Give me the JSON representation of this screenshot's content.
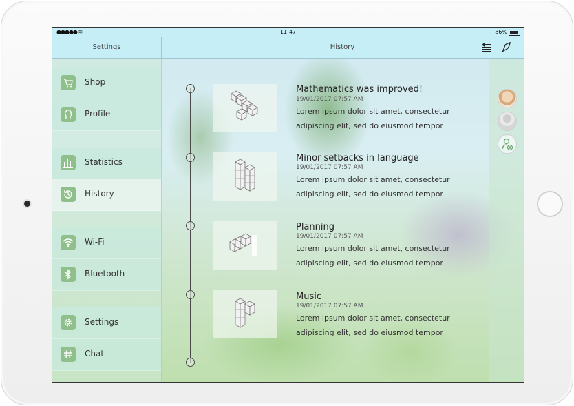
{
  "statusbar": {
    "signal": "●●●●● ≋",
    "time": "11:47",
    "battery": "86%"
  },
  "navbar": {
    "left_title": "Settings",
    "center_title": "History"
  },
  "sidebar": {
    "items": [
      {
        "label": "Shop",
        "icon": "cart-icon"
      },
      {
        "label": "Profile",
        "icon": "head-icon"
      },
      {
        "label": "Statistics",
        "icon": "bar-chart-icon"
      },
      {
        "label": "History",
        "icon": "history-icon"
      },
      {
        "label": "Wi-Fi",
        "icon": "wifi-icon"
      },
      {
        "label": "Bluetooth",
        "icon": "bluetooth-icon"
      },
      {
        "label": "Settings",
        "icon": "gear-icon"
      },
      {
        "label": "Chat",
        "icon": "hashtag-icon"
      }
    ]
  },
  "entries": [
    {
      "title": "Mathematics was improved!",
      "date": "19/01/2017 07:57 AM",
      "line1": "Lorem ipsum dolor sit amet, consectetur",
      "line2": "adipiscing elit, sed do eiusmod tempor"
    },
    {
      "title": "Minor setbacks in language",
      "date": "19/01/2017 07:57 AM",
      "line1": "Lorem ipsum dolor sit amet, consectetur",
      "line2": "adipiscing elit, sed do eiusmod tempor"
    },
    {
      "title": "Planning",
      "date": "19/01/2017 07:57 AM",
      "line1": "Lorem ipsum dolor sit amet, consectetur",
      "line2": "adipiscing elit, sed do eiusmod tempor"
    },
    {
      "title": "Music",
      "date": "19/01/2017 07:57 AM",
      "line1": "Lorem ipsum dolor sit amet, consectetur",
      "line2": "adipiscing elit, sed do eiusmod tempor"
    }
  ],
  "colors": {
    "accent": "#8fbf8b",
    "bar": "#c6eef6"
  }
}
